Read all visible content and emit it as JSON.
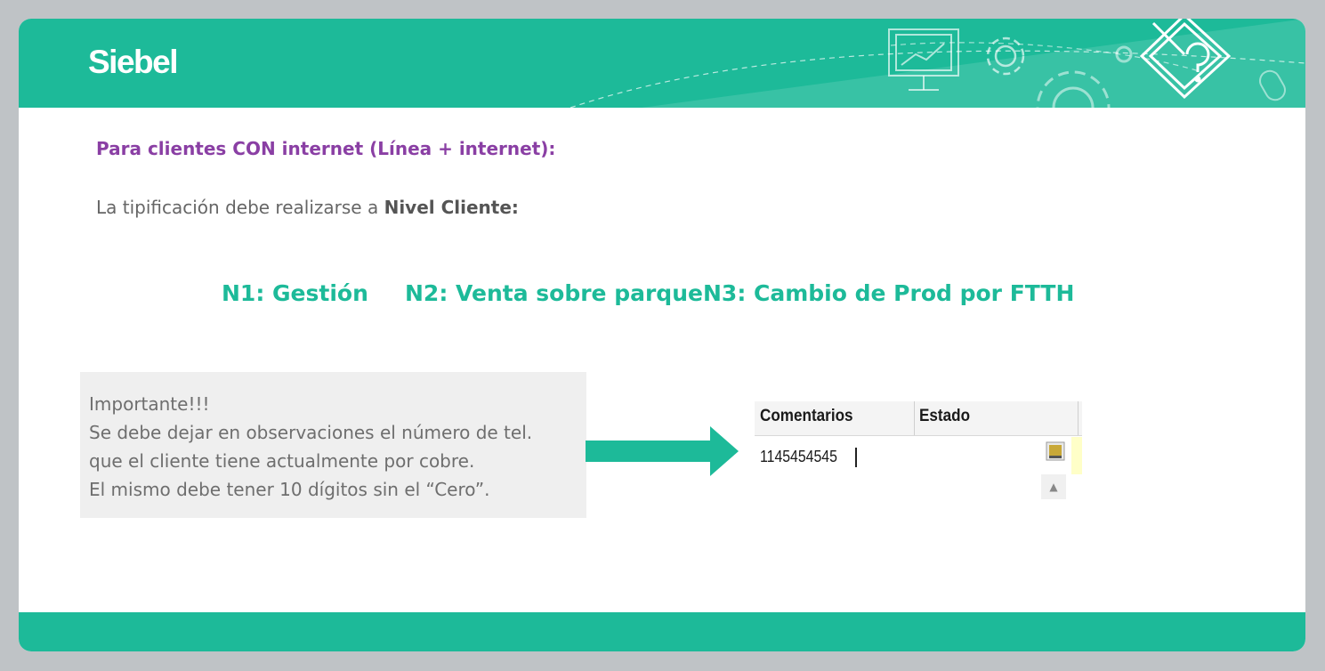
{
  "header": {
    "brand": "Siebel",
    "icons": [
      "presentation-board-icon",
      "gear-icon",
      "large-gear-icon",
      "question-document-icon",
      "mouse-icon"
    ]
  },
  "content": {
    "subtitle": "Para clientes CON internet (Línea + internet):",
    "instruction_prefix": "La tipificación debe realizarse a ",
    "instruction_bold": "Nivel Cliente:",
    "levels": [
      "N1: Gestión",
      "N2: Venta sobre parque",
      "N3: Cambio de Prod por FTTH"
    ]
  },
  "note": {
    "lines": [
      "Importante!!!",
      "Se debe dejar en observaciones el número de tel.",
      "que el cliente tiene actualmente por cobre.",
      "El mismo debe tener 10 dígitos sin el “Cero”."
    ]
  },
  "snippet": {
    "columns": [
      "Comentarios",
      "Estado"
    ],
    "value": "1145454545"
  },
  "colors": {
    "accent": "#1dba99",
    "subtitle": "#8a3fa4",
    "text_gray": "#666666",
    "background": "#bfc3c6"
  }
}
